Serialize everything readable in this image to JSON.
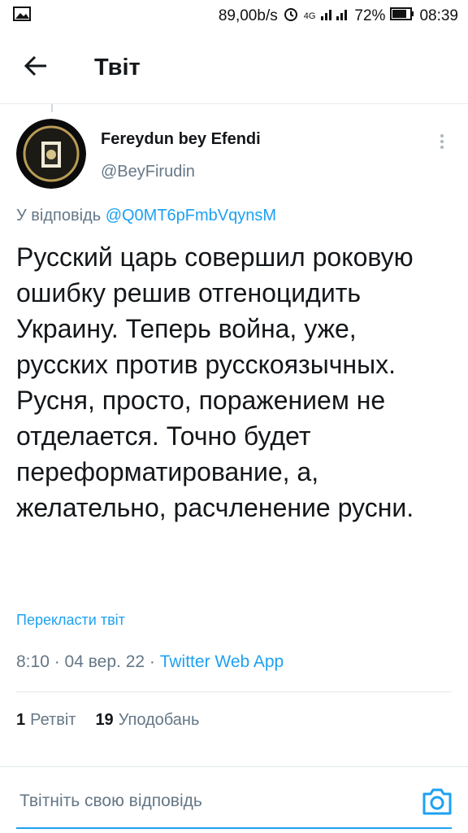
{
  "status_bar": {
    "speed": "89,00b/s",
    "network": "4G",
    "battery": "72%",
    "time": "08:39"
  },
  "header": {
    "title": "Твіт",
    "back_icon": "arrow-left-icon"
  },
  "tweet": {
    "author_name": "Fereydun bey Efendi",
    "author_handle": "@BeyFirudin",
    "reply_prefix": "У відповідь",
    "reply_to": "@Q0MT6pFmbVqynsM",
    "text": "Русский царь совершил роковую ошибку решив отгеноцидить Украину. Теперь война, уже, русских против русскоязычных. Русня, просто, поражением не отделается. Точно будет переформатирование, а, желательно, расчленение русни.",
    "translate": "Перекласти твіт",
    "time": "8:10",
    "date": "04 вер. 22",
    "source": "Twitter Web App",
    "retweets_count": "1",
    "retweets_label": "Ретвіт",
    "likes_count": "19",
    "likes_label": "Уподобань"
  },
  "reply_box": {
    "placeholder": "Твітніть свою відповідь",
    "camera_icon": "camera-icon"
  },
  "colors": {
    "accent": "#1da1f2",
    "muted": "#657786",
    "text": "#14171a"
  }
}
